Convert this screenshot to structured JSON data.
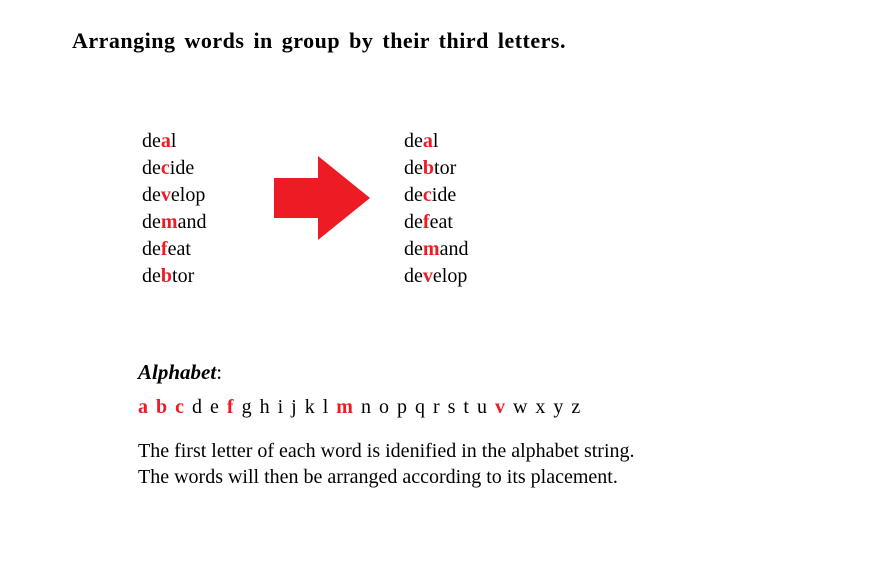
{
  "title": "Arranging words in group by their  third  letters.",
  "left_words": [
    {
      "pre": "de",
      "h": "a",
      "post": "l"
    },
    {
      "pre": "de",
      "h": "c",
      "post": "ide"
    },
    {
      "pre": "de",
      "h": "v",
      "post": "elop"
    },
    {
      "pre": "de",
      "h": "m",
      "post": "and"
    },
    {
      "pre": "de",
      "h": "f",
      "post": "eat"
    },
    {
      "pre": "de",
      "h": "b",
      "post": "tor"
    }
  ],
  "right_words": [
    {
      "pre": "de",
      "h": "a",
      "post": "l"
    },
    {
      "pre": "de",
      "h": "b",
      "post": "tor"
    },
    {
      "pre": "de",
      "h": "c",
      "post": "ide"
    },
    {
      "pre": "de",
      "h": "f",
      "post": "eat"
    },
    {
      "pre": "de",
      "h": "m",
      "post": "and"
    },
    {
      "pre": "de",
      "h": "v",
      "post": "elop"
    }
  ],
  "alpha_label": "Alphabet",
  "alpha_colon": ":",
  "alphabet": [
    {
      "l": "a",
      "h": true
    },
    {
      "l": "b",
      "h": true
    },
    {
      "l": "c",
      "h": true
    },
    {
      "l": "d",
      "h": false
    },
    {
      "l": "e",
      "h": false
    },
    {
      "l": "f",
      "h": true
    },
    {
      "l": "g",
      "h": false
    },
    {
      "l": "h",
      "h": false
    },
    {
      "l": "i",
      "h": false
    },
    {
      "l": "j",
      "h": false
    },
    {
      "l": "k",
      "h": false
    },
    {
      "l": "l",
      "h": false
    },
    {
      "l": "m",
      "h": true
    },
    {
      "l": "n",
      "h": false
    },
    {
      "l": "o",
      "h": false
    },
    {
      "l": "p",
      "h": false
    },
    {
      "l": "q",
      "h": false
    },
    {
      "l": "r",
      "h": false
    },
    {
      "l": "s",
      "h": false
    },
    {
      "l": "t",
      "h": false
    },
    {
      "l": "u",
      "h": false
    },
    {
      "l": "v",
      "h": true
    },
    {
      "l": "w",
      "h": false
    },
    {
      "l": "x",
      "h": false
    },
    {
      "l": "y",
      "h": false
    },
    {
      "l": "z",
      "h": false
    }
  ],
  "explain": "The first letter of each word is idenified in the alphabet string. The words will then be arranged according to its placement.",
  "arrow_color": "#ed1c24"
}
